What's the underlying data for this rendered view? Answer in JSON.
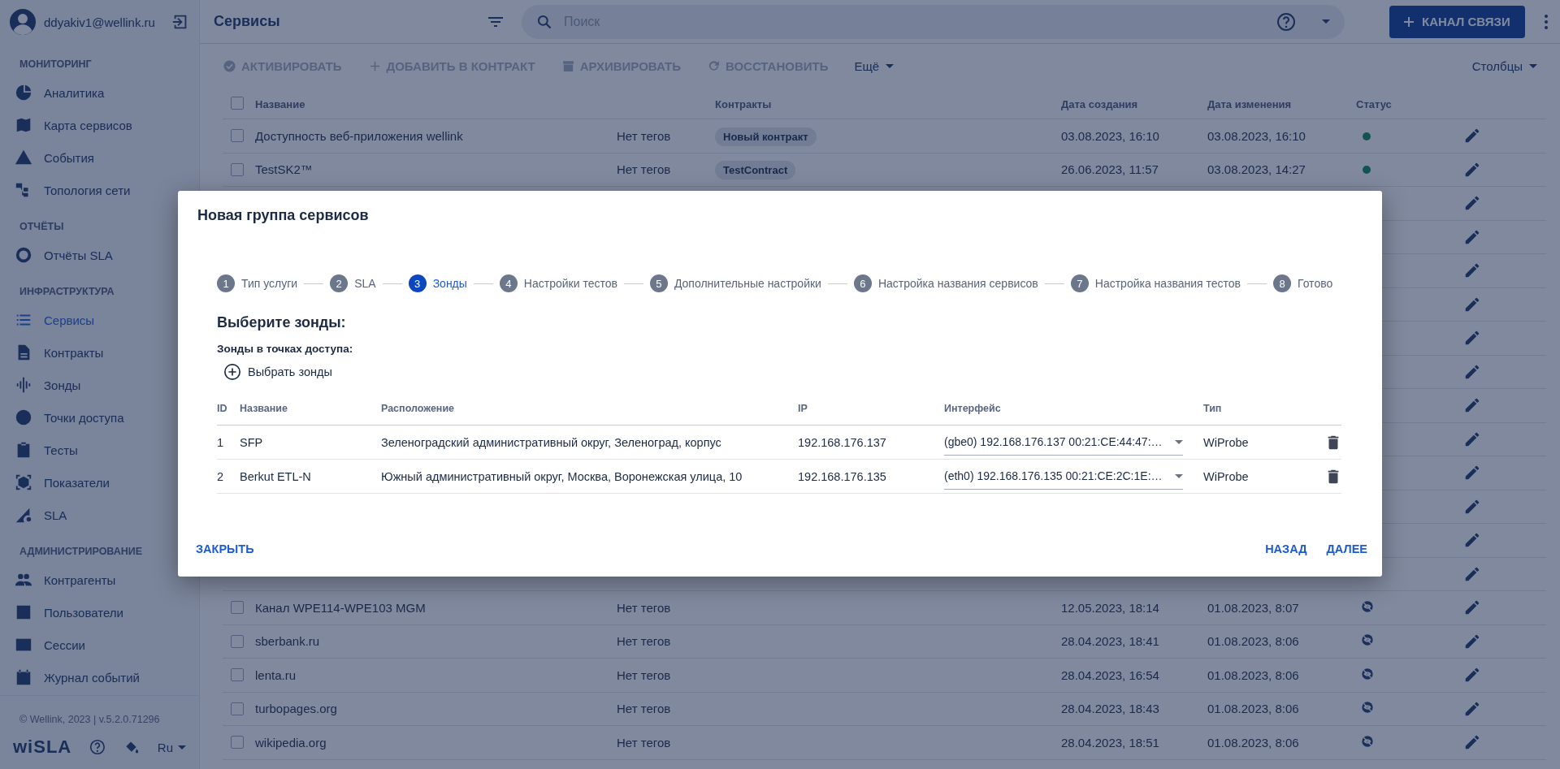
{
  "sidebar": {
    "user": "ddyakiv1@wellink.ru",
    "sections": [
      {
        "title": "МОНИТОРИНГ",
        "items": [
          {
            "label": "Аналитика",
            "selected": false
          },
          {
            "label": "Карта сервисов",
            "selected": false
          },
          {
            "label": "События",
            "selected": false
          },
          {
            "label": "Топология сети",
            "selected": false
          }
        ]
      },
      {
        "title": "ОТЧЁТЫ",
        "items": [
          {
            "label": "Отчёты SLA",
            "selected": false
          }
        ]
      },
      {
        "title": "ИНФРАСТРУКТУРА",
        "items": [
          {
            "label": "Сервисы",
            "selected": true
          },
          {
            "label": "Контракты",
            "selected": false
          },
          {
            "label": "Зонды",
            "selected": false
          },
          {
            "label": "Точки доступа",
            "selected": false
          },
          {
            "label": "Тесты",
            "selected": false
          },
          {
            "label": "Показатели",
            "selected": false
          },
          {
            "label": "SLA",
            "selected": false
          }
        ]
      },
      {
        "title": "АДМИНИСТРИРОВАНИЕ",
        "items": [
          {
            "label": "Контрагенты",
            "selected": false
          },
          {
            "label": "Пользователи",
            "selected": false
          },
          {
            "label": "Сессии",
            "selected": false
          },
          {
            "label": "Журнал событий",
            "selected": false
          }
        ]
      }
    ],
    "footer": "© Wellink, 2023 | v.5.2.0.71296",
    "logo": "wiSLA",
    "language": "Ru"
  },
  "header": {
    "title": "Сервисы",
    "search": {
      "placeholder": "Поиск"
    },
    "button": "КАНАЛ СВЯЗИ"
  },
  "toolbar": {
    "actions": [
      {
        "label": "АКТИВИРОВАТЬ",
        "kind": "activate",
        "disabled": true
      },
      {
        "label": "ДОБАВИТЬ В КОНТРАКТ",
        "kind": "add",
        "disabled": true
      },
      {
        "label": "АРХИВИРОВАТЬ",
        "kind": "archive",
        "disabled": true
      },
      {
        "label": "ВОССТАНОВИТЬ",
        "kind": "restore",
        "disabled": true
      }
    ],
    "more": "Ещё",
    "columns": "Столбцы"
  },
  "table": {
    "all_selected": false,
    "columns": [
      "Название",
      "",
      "Контракты",
      "Дата создания",
      "Дата изменения",
      "Статус"
    ],
    "rows": [
      {
        "selected": false,
        "name": "Доступность веб-приложения wellink",
        "tags": "Нет тегов",
        "contract": "Новый контракт",
        "created": "03.08.2023, 16:10",
        "modified": "03.08.2023, 16:10",
        "archived": false
      },
      {
        "selected": false,
        "name": "TestSK2™",
        "tags": "Нет тегов",
        "contract": "TestContract",
        "created": "26.06.2023, 11:57",
        "modified": "03.08.2023, 14:27",
        "archived": false
      },
      {},
      {},
      {},
      {},
      {},
      {},
      {},
      {},
      {},
      {},
      {},
      {},
      {
        "selected": false,
        "name": "Канал WPE114-WPE103 MGM",
        "tags": "Нет тегов",
        "created": "12.05.2023, 18:14",
        "modified": "01.08.2023, 8:07",
        "archived": true
      },
      {
        "selected": false,
        "name": "sberbank.ru",
        "tags": "Нет тегов",
        "created": "28.04.2023, 18:41",
        "modified": "01.08.2023, 8:06",
        "archived": true
      },
      {
        "selected": false,
        "name": "lenta.ru",
        "tags": "Нет тегов",
        "created": "28.04.2023, 16:54",
        "modified": "01.08.2023, 8:06",
        "archived": true
      },
      {
        "selected": false,
        "name": "turbopages.org",
        "tags": "Нет тегов",
        "created": "28.04.2023, 18:43",
        "modified": "01.08.2023, 8:06",
        "archived": true
      },
      {
        "selected": false,
        "name": "wikipedia.org",
        "tags": "Нет тегов",
        "created": "28.04.2023, 18:51",
        "modified": "01.08.2023, 8:06",
        "archived": true
      }
    ]
  },
  "dialog": {
    "title": "Новая группа сервисов",
    "steps": [
      {
        "number": "1",
        "label": "Тип услуги",
        "selected": false
      },
      {
        "number": "2",
        "label": "SLA",
        "selected": false
      },
      {
        "number": "3",
        "label": "Зонды",
        "selected": true
      },
      {
        "number": "4",
        "label": "Настройки тестов",
        "selected": false
      },
      {
        "number": "5",
        "label": "Дополнительные настройки",
        "selected": false
      },
      {
        "number": "6",
        "label": "Настройка названия сервисов",
        "selected": false
      },
      {
        "number": "7",
        "label": "Настройка названия тестов",
        "selected": false
      },
      {
        "number": "8",
        "label": "Готово",
        "selected": false
      }
    ],
    "heading": "Выберите зонды:",
    "subheading": "Зонды в точках доступа:",
    "add_button": "Выбрать зонды",
    "table": {
      "columns": [
        "ID",
        "Название",
        "Расположение",
        "IP",
        "Интерфейс",
        "Тип"
      ],
      "rows": [
        {
          "id": "1",
          "name": "SFP",
          "location": "Зеленоградский административный округ, Зеленоград, корпус",
          "ip": "192.168.176.137",
          "interface": "(gbe0) 192.168.176.137 00:21:CE:44:47:…",
          "type": "WiProbe"
        },
        {
          "id": "2",
          "name": "Berkut ETL-N",
          "location": "Южный административный округ, Москва, Воронежская улица, 10",
          "ip": "192.168.176.135",
          "interface": "(eth0) 192.168.176.135 00:21:CE:2C:1E:…",
          "type": "WiProbe"
        }
      ]
    },
    "close": "ЗАКРЫТЬ",
    "back": "НАЗАД",
    "next": "ДАЛЕЕ"
  }
}
